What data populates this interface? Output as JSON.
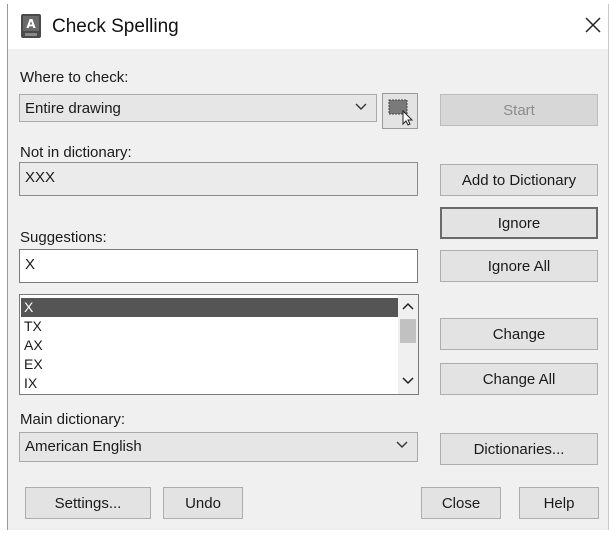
{
  "window": {
    "title": "Check Spelling",
    "close_icon": "close-icon",
    "app_icon": "autocad-icon"
  },
  "where_to_check": {
    "label": "Where to check:",
    "value": "Entire drawing"
  },
  "not_in_dictionary": {
    "label": "Not in dictionary:",
    "value": "XXX"
  },
  "suggestions": {
    "label": "Suggestions:",
    "value": "X",
    "items": [
      "X",
      "TX",
      "AX",
      "EX",
      "IX"
    ],
    "selected_index": 0
  },
  "main_dictionary": {
    "label": "Main dictionary:",
    "value": "American English"
  },
  "buttons": {
    "start": "Start",
    "add_to_dictionary": "Add to Dictionary",
    "ignore": "Ignore",
    "ignore_all": "Ignore All",
    "change": "Change",
    "change_all": "Change All",
    "dictionaries": "Dictionaries...",
    "settings": "Settings...",
    "undo": "Undo",
    "close": "Close",
    "help": "Help"
  },
  "colors": {
    "dialog_bg": "#f0f0f0",
    "selection": "#555555"
  }
}
